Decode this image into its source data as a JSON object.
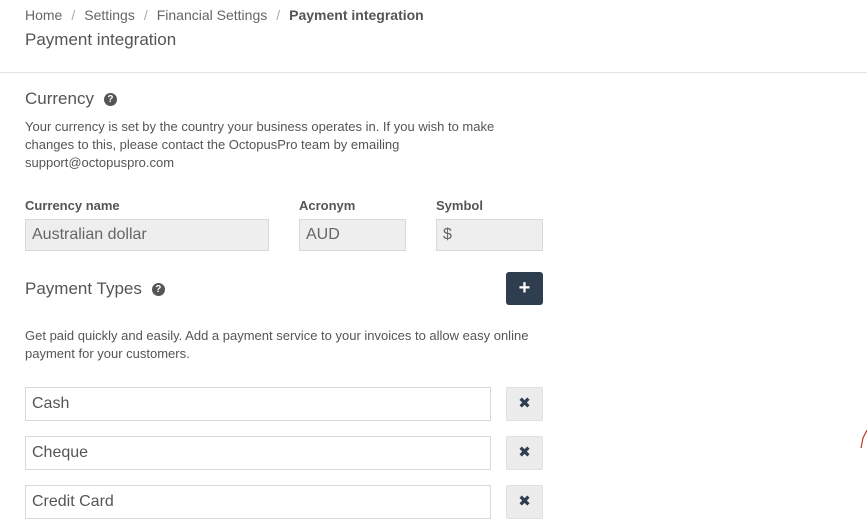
{
  "breadcrumb": {
    "items": [
      "Home",
      "Settings",
      "Financial Settings"
    ],
    "current": "Payment integration",
    "separator": "/"
  },
  "page": {
    "title": "Payment integration"
  },
  "currency": {
    "heading": "Currency",
    "help_icon": "question-circle-icon",
    "description": "Your currency is set by the country your business operates in. If you wish to make changes to this, please contact the OctopusPro team by emailing support@octopuspro.com",
    "fields": {
      "name_label": "Currency name",
      "name_value": "Australian dollar",
      "acronym_label": "Acronym",
      "acronym_value": "AUD",
      "symbol_label": "Symbol",
      "symbol_value": "$"
    }
  },
  "payment_types": {
    "heading": "Payment Types",
    "help_icon": "question-circle-icon",
    "add_icon": "+",
    "description": "Get paid quickly and easily. Add a payment service to your invoices to allow easy online payment for your customers.",
    "remove_icon": "✖",
    "items": [
      "Cash",
      "Cheque",
      "Credit Card"
    ]
  },
  "colors": {
    "accent": "#2e3e4f",
    "readonly_bg": "#eeeeee",
    "text": "#555555"
  }
}
